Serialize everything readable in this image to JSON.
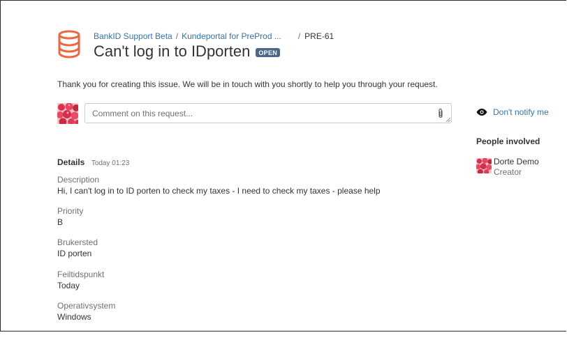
{
  "breadcrumb": {
    "project": "BankID Support Beta",
    "portal": "Kundeportal for PreProd ...",
    "issue_key": "PRE-61"
  },
  "issue": {
    "title": "Can't log in to IDporten",
    "status": "OPEN"
  },
  "thanks_message": "Thank you for creating this issue. We will be in touch with you shortly to help you through your request.",
  "comment": {
    "placeholder": "Comment on this request...",
    "value": ""
  },
  "notify": {
    "label": "Don't notify me"
  },
  "people": {
    "heading": "People involved",
    "items": [
      {
        "name": "Dorte Demo",
        "role": "Creator"
      }
    ]
  },
  "details": {
    "label": "Details",
    "time": "Today 01:23",
    "fields": [
      {
        "label": "Description",
        "value": "Hi, I can't log in to ID porten to check my taxes - I need to check my taxes - please help"
      },
      {
        "label": "Priority",
        "value": "B"
      },
      {
        "label": "Brukersted",
        "value": "ID porten"
      },
      {
        "label": "Feiltidspunkt",
        "value": "Today"
      },
      {
        "label": "Operativsystem",
        "value": "Windows"
      }
    ]
  },
  "colors": {
    "link": "#3572b0",
    "status_bg": "#4a6785",
    "icon_orange": "#f0663c"
  },
  "icons": {
    "project": "database-icon",
    "attach": "paperclip-icon",
    "watch": "eye-icon"
  }
}
